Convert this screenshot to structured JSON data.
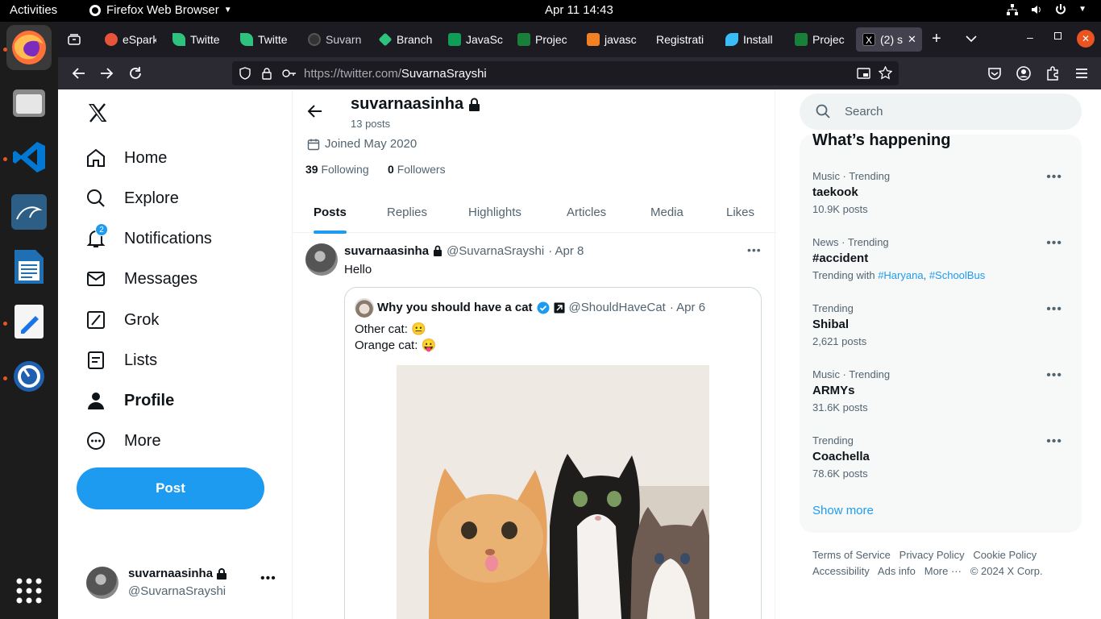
{
  "system": {
    "activities": "Activities",
    "app_name": "Firefox Web Browser",
    "clock": "Apr 11  14:43"
  },
  "dock": {
    "apps": [
      "firefox-icon",
      "files-icon",
      "vscode-icon",
      "mysql-workbench-icon",
      "libreoffice-writer-icon",
      "text-editor-icon",
      "timer-icon"
    ],
    "show_apps_icon": "app-grid-icon"
  },
  "browser": {
    "tabs": [
      {
        "label": "eSpark",
        "color": "#e8543a"
      },
      {
        "label": "Twitte",
        "color": "#2ec27e"
      },
      {
        "label": "Twitte",
        "color": "#2ec27e"
      },
      {
        "label": "Suvarn",
        "color": "#24292f"
      },
      {
        "label": "Branch",
        "color": "#2ec27e"
      },
      {
        "label": "JavaSc",
        "color": "#0f9d58"
      },
      {
        "label": "Projec",
        "color": "#188038"
      },
      {
        "label": "javasc",
        "color": "#f48024"
      },
      {
        "label": "Registrati",
        "color": ""
      },
      {
        "label": "Install",
        "color": "#38bdf8"
      },
      {
        "label": "Projec",
        "color": "#188038"
      },
      {
        "label": "(2) s",
        "color": "#000000"
      }
    ],
    "url_host": "https://twitter.com/",
    "url_path": "SuvarnaSrayshi"
  },
  "leftnav": {
    "items": [
      {
        "label": "Home",
        "icon": "home-icon"
      },
      {
        "label": "Explore",
        "icon": "search-icon"
      },
      {
        "label": "Notifications",
        "icon": "bell-icon"
      },
      {
        "label": "Messages",
        "icon": "envelope-icon"
      },
      {
        "label": "Grok",
        "icon": "grok-icon"
      },
      {
        "label": "Lists",
        "icon": "list-icon"
      },
      {
        "label": "Profile",
        "icon": "person-icon"
      },
      {
        "label": "More",
        "icon": "more-circle-icon"
      }
    ],
    "notification_badge": "2",
    "post_label": "Post",
    "account": {
      "name": "suvarnaasinha",
      "handle": "@SuvarnaSrayshi"
    }
  },
  "profile": {
    "name": "suvarnaasinha",
    "posts_count": "13 posts",
    "joined": "Joined May 2020",
    "following_count": "39",
    "following_label": "Following",
    "followers_count": "0",
    "followers_label": "Followers",
    "tabs": [
      "Posts",
      "Replies",
      "Highlights",
      "Articles",
      "Media",
      "Likes"
    ]
  },
  "tweet": {
    "name": "suvarnaasinha",
    "handle": "@SuvarnaSrayshi",
    "date": "· Apr 8",
    "text": "Hello",
    "quote": {
      "name": "Why you should have a cat",
      "handle": "@ShouldHaveCat",
      "date": "· Apr 6",
      "line1": "Other cat: 😐",
      "line2": "Orange cat: 😛"
    }
  },
  "sidebar": {
    "search_placeholder": "Search",
    "heading": "What’s happening",
    "trends": [
      {
        "meta": "Music · Trending",
        "name": "taekook",
        "count": "10.9K posts"
      },
      {
        "meta": "News · Trending",
        "name": "#accident",
        "count": "Trending with",
        "links": [
          "#Haryana",
          "#SchoolBus"
        ]
      },
      {
        "meta": "Trending",
        "name": "Shibal",
        "count": "2,621 posts"
      },
      {
        "meta": "Music · Trending",
        "name": "ARMYs",
        "count": "31.6K posts"
      },
      {
        "meta": "Trending",
        "name": "Coachella",
        "count": "78.6K posts"
      }
    ],
    "show_more": "Show more",
    "footer": [
      "Terms of Service",
      "Privacy Policy",
      "Cookie Policy",
      "Accessibility",
      "Ads info",
      "More ···",
      "© 2024 X Corp."
    ]
  },
  "colors": {
    "accent": "#1d9bf0",
    "text": "#0f1419",
    "muted": "#536471"
  }
}
